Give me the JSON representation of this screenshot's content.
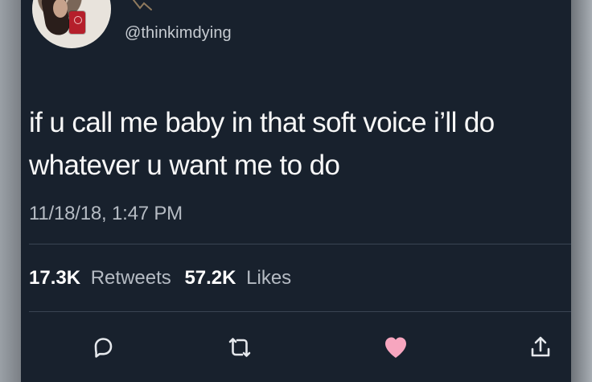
{
  "tweet": {
    "handle": "@thinkimdying",
    "text": "if u call me baby in that soft voice i’ll do whatever u want me to do",
    "timestamp": "11/18/18, 1:47 PM",
    "retweets_count": "17.3K",
    "retweets_label": "Retweets",
    "likes_count": "57.2K",
    "likes_label": "Likes"
  },
  "icons": {
    "reply": "reply-icon",
    "retweet": "retweet-icon",
    "like": "heart-icon",
    "share": "share-icon"
  },
  "colors": {
    "background": "#18212d",
    "primary_text": "#f7f7f7",
    "secondary_text": "#b5bbc3",
    "divider": "#3a4452",
    "like": "#f7a6bf",
    "icon": "#e5e8ec"
  }
}
